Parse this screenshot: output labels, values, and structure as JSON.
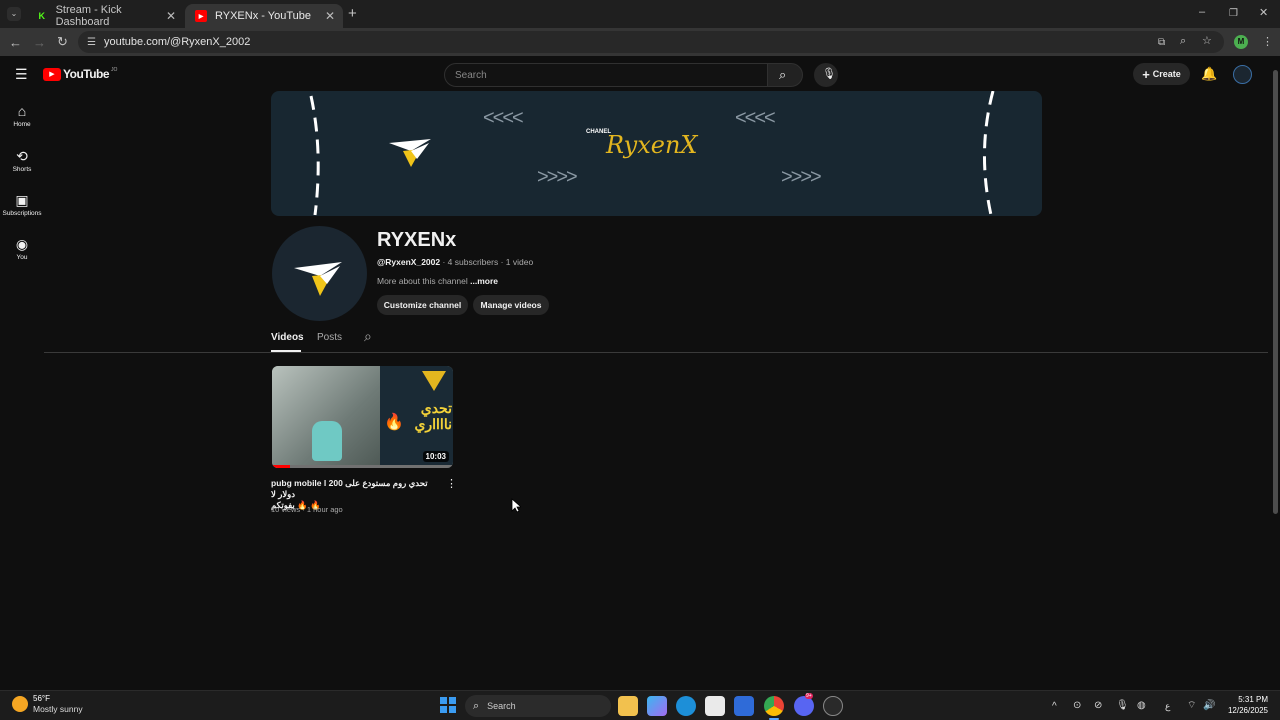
{
  "browser": {
    "tabs": [
      {
        "title": "Stream - Kick Dashboard",
        "active": false
      },
      {
        "title": "RYXENx - YouTube",
        "active": true
      }
    ],
    "url": "youtube.com/@RyxenX_2002",
    "profile_initial": "M",
    "colors": {
      "profile": "#4caf50",
      "kick": "#53fc18",
      "youtube": "#ff0000"
    }
  },
  "youtube": {
    "logo_text": "YouTube",
    "region": "JO",
    "search_placeholder": "Search",
    "create_label": "Create",
    "sidebar": [
      {
        "label": "Home",
        "icon": "home-icon"
      },
      {
        "label": "Shorts",
        "icon": "shorts-icon"
      },
      {
        "label": "Subscriptions",
        "icon": "subscriptions-icon"
      },
      {
        "label": "You",
        "icon": "you-icon"
      }
    ],
    "banner": {
      "channel_word": "CHANEL",
      "brand": "RyxenX",
      "arrows_left": "<<<<",
      "arrows_right": ">>>>"
    },
    "channel": {
      "name": "RYXENx",
      "handle": "@RyxenX_2002",
      "stats": " · 4 subscribers · 1 video",
      "about": "More about this channel",
      "more": "...more",
      "customize_label": "Customize channel",
      "manage_label": "Manage videos"
    },
    "tabs": [
      "Videos",
      "Posts"
    ],
    "video": {
      "title_line1": "pubg mobile l تحدي روم مستودع على 200 دولار لا",
      "title_line2": "يفوتكم 🔥 🔥",
      "meta": "10 views · 1 hour ago",
      "duration": "10:03",
      "thumb_text": "تحدي\nنااااري",
      "watch_progress": 0.1
    }
  },
  "taskbar": {
    "temperature": "56°F",
    "weather": "Mostly sunny",
    "search_label": "Search",
    "time": "5:31 PM",
    "date": "12/26/2025",
    "lang": "ع",
    "discord_badge": "9+"
  }
}
